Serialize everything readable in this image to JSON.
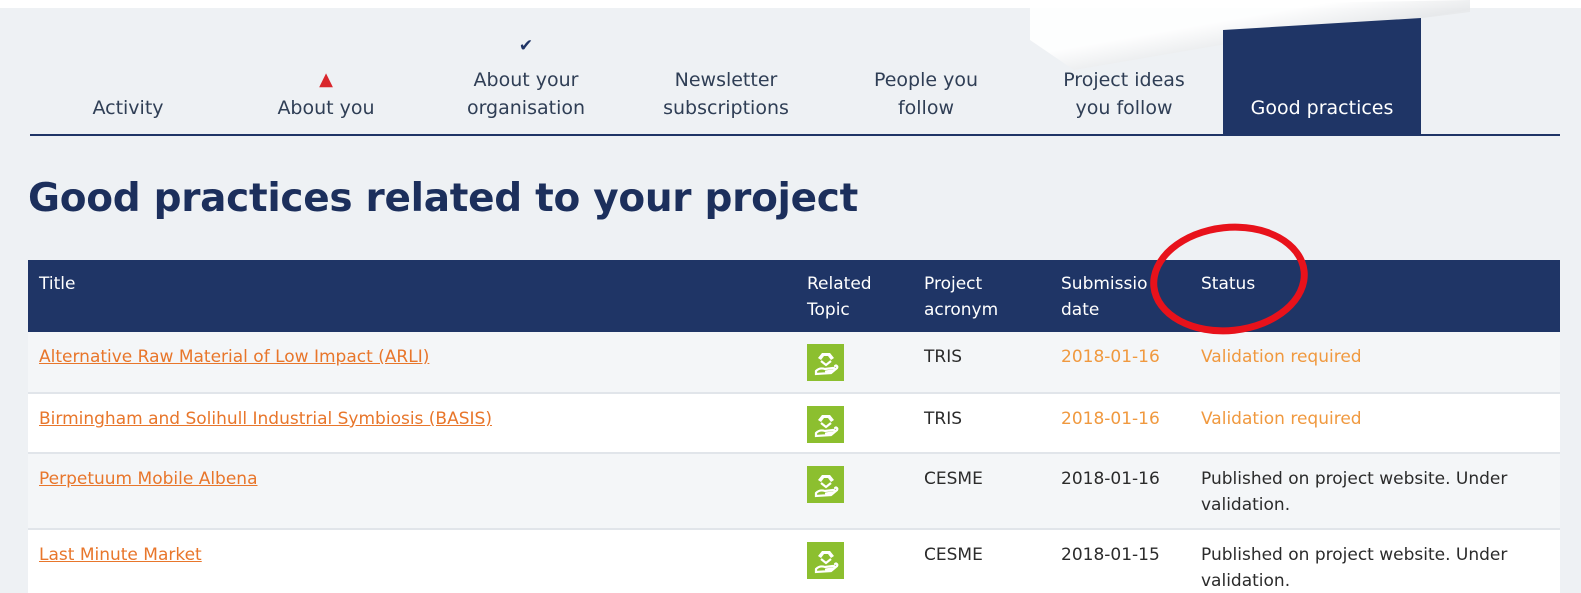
{
  "tabs": [
    {
      "label": "Activity",
      "mark": ""
    },
    {
      "label": "About you",
      "mark": "▲"
    },
    {
      "label": "About your\norganisation",
      "mark": "✔"
    },
    {
      "label": "Newsletter\nsubscriptions",
      "mark": ""
    },
    {
      "label": "People you\nfollow",
      "mark": ""
    },
    {
      "label": "Project ideas\nyou follow",
      "mark": ""
    },
    {
      "label": "Good practices",
      "mark": ""
    }
  ],
  "page_title": "Good practices related to your project",
  "table": {
    "headers": {
      "title": "Title",
      "topic": "Related\nTopic",
      "acronym": "Project\nacronym",
      "date": "Submissio\ndate",
      "status": "Status"
    },
    "rows": [
      {
        "title": "Alternative Raw Material of Low Impact (ARLI)",
        "acronym": "TRIS",
        "date": "2018-01-16",
        "status": "Validation required"
      },
      {
        "title": "Birmingham and Solihull Industrial Symbiosis (BASIS)",
        "acronym": "TRIS",
        "date": "2018-01-16",
        "status": "Validation required"
      },
      {
        "title": "Perpetuum Mobile Albena",
        "acronym": "CESME",
        "date": "2018-01-16",
        "status": "Published on project website. Under validation."
      },
      {
        "title": "Last Minute Market",
        "acronym": "CESME",
        "date": "2018-01-15",
        "status": "Published on project website. Under validation."
      }
    ],
    "topic_icon": "recycling-hand-icon"
  },
  "colors": {
    "navy": "#1f3566",
    "link_orange": "#e8762b",
    "status_orange": "#f0993f",
    "topic_green": "#8cbf2f",
    "highlight_red": "#e8121b"
  }
}
